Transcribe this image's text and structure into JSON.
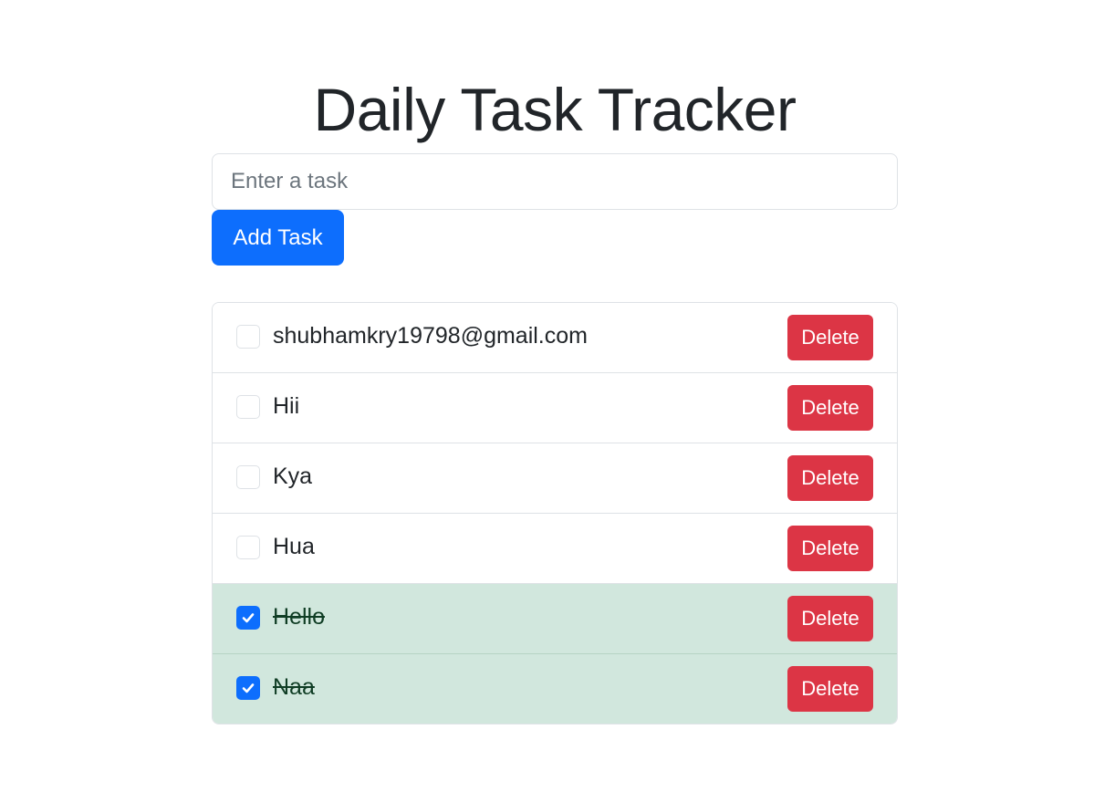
{
  "app": {
    "title": "Daily Task Tracker"
  },
  "form": {
    "input_placeholder": "Enter a task",
    "input_value": "",
    "add_button_label": "Add Task"
  },
  "tasks": [
    {
      "text": "shubhamkry19798@gmail.com",
      "completed": false,
      "delete_label": "Delete"
    },
    {
      "text": "Hii",
      "completed": false,
      "delete_label": "Delete"
    },
    {
      "text": "Kya",
      "completed": false,
      "delete_label": "Delete"
    },
    {
      "text": "Hua",
      "completed": false,
      "delete_label": "Delete"
    },
    {
      "text": "Hello",
      "completed": true,
      "delete_label": "Delete"
    },
    {
      "text": "Naa",
      "completed": true,
      "delete_label": "Delete"
    }
  ],
  "colors": {
    "primary": "#0d6efd",
    "danger": "#dc3545",
    "completed_bg": "#d1e7dd"
  },
  "icons": {
    "checkbox_checked": "check-icon"
  }
}
